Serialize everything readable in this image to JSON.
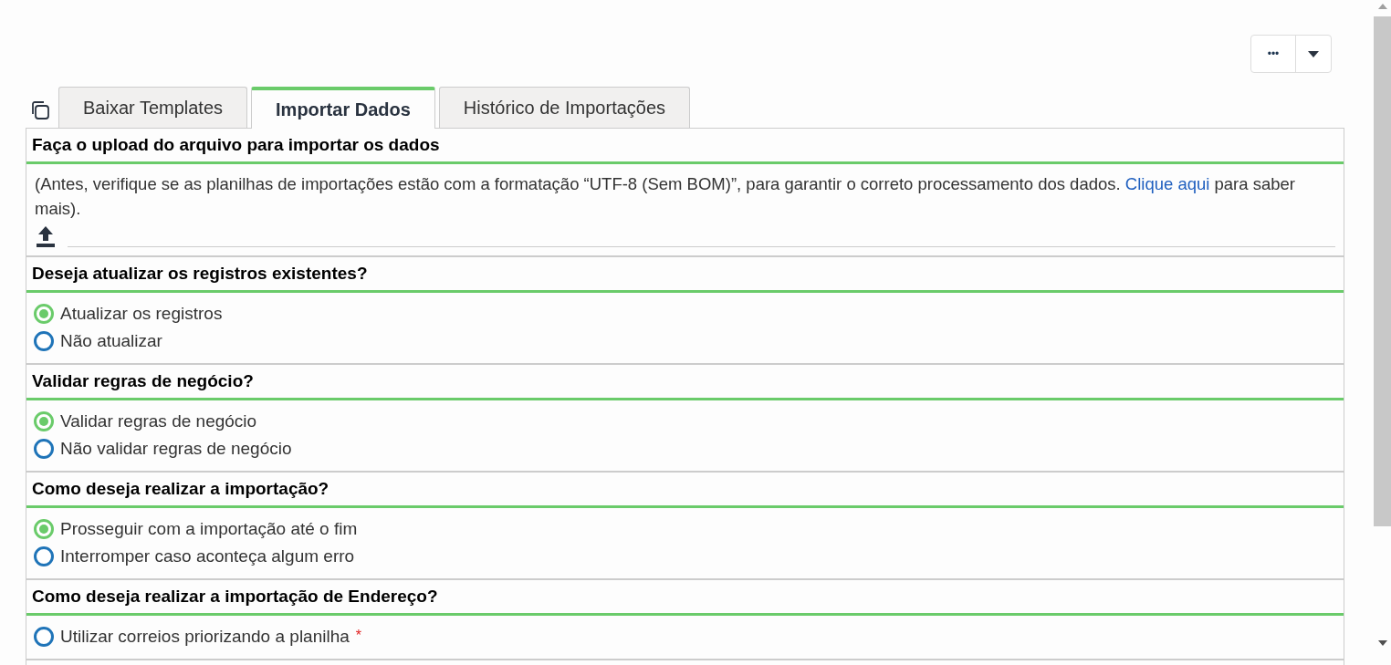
{
  "toolbar": {
    "more_label": "•••"
  },
  "tabs": [
    {
      "label": "Baixar Templates",
      "selected": false
    },
    {
      "label": "Importar Dados",
      "selected": true
    },
    {
      "label": "Histórico de Importações",
      "selected": false
    }
  ],
  "upload": {
    "title": "Faça o upload do arquivo para importar os dados",
    "note_before": "(Antes, verifique se as planilhas de importações estão com a formatação “UTF-8 (Sem BOM)”, para garantir o correto processamento dos dados.",
    "link": "Clique aqui",
    "note_after": "para saber mais)."
  },
  "groups": [
    {
      "title": "Deseja atualizar os registros existentes?",
      "options": [
        {
          "label": "Atualizar os registros",
          "selected": true
        },
        {
          "label": "Não atualizar",
          "selected": false
        }
      ]
    },
    {
      "title": "Validar regras de negócio?",
      "options": [
        {
          "label": "Validar regras de negócio",
          "selected": true
        },
        {
          "label": "Não validar regras de negócio",
          "selected": false
        }
      ]
    },
    {
      "title": "Como deseja realizar a importação?",
      "options": [
        {
          "label": "Prosseguir com a importação até o fim",
          "selected": true
        },
        {
          "label": "Interromper caso aconteça algum erro",
          "selected": false
        }
      ]
    },
    {
      "title": "Como deseja realizar a importação de Endereço?",
      "required_mark": "*",
      "options": [
        {
          "label": "Utilizar correios priorizando a planilha",
          "selected": false
        }
      ]
    }
  ]
}
